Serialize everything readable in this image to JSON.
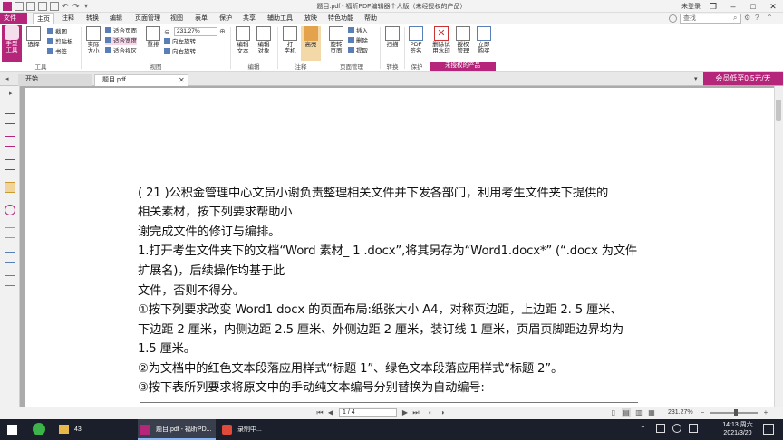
{
  "window": {
    "title": "题目.pdf - 福昕PDF编辑器个人版（未经授权的产品）",
    "login": "未登录"
  },
  "menu": {
    "items": [
      "文件",
      "主页",
      "注释",
      "转换",
      "编辑",
      "页面管理",
      "视图",
      "表单",
      "保护",
      "共享",
      "辅助工具",
      "放映",
      "特色功能",
      "帮助"
    ],
    "active": "主页",
    "search_placeholder": "查找"
  },
  "ribbon": {
    "tools_group": {
      "label": "工具",
      "hand": "手型\n工具",
      "select": "选择",
      "snapshot": "截图",
      "clipboard": "剪贴板",
      "bookmark": "书签"
    },
    "view_group": {
      "label": "视图",
      "actual": "实际\n大小",
      "fit_page": "适合页面",
      "fit_width": "适合宽度",
      "fit_view": "适合视区",
      "reflow": "重排",
      "zoom_value": "231.27%",
      "rotate_left": "向左旋转",
      "rotate_right": "向右旋转"
    },
    "edit_group": {
      "label": "编辑",
      "edit_text": "编辑\n文本",
      "edit_object": "编辑\n对象"
    },
    "annot_group": {
      "label": "注释",
      "typewriter": "打\n字机",
      "highlight": "高亮"
    },
    "page_group": {
      "label": "页面管理",
      "rotate": "旋转\n页面",
      "insert": "插入",
      "delete": "删除",
      "extract": "提取"
    },
    "convert_group": {
      "label": "转换",
      "scan": "扫描"
    },
    "protect_group": {
      "label": "保护",
      "sign": "PDF\n签名"
    },
    "unlicensed_group": {
      "label": "未授权的产品",
      "remove_watermark": "删除试\n用水印",
      "license": "授权\n管理",
      "buy": "立即\n购买"
    }
  },
  "promo": "会员低至0.5元/天",
  "tabs": [
    {
      "label": "开始"
    },
    {
      "label": "题目.pdf"
    }
  ],
  "document": {
    "lines": [
      "( 21 )公积金管理中心文员小谢负责整理相关文件并下发各部门，利用考生文件夹下提供的",
      "相关素材，按下列要求帮助小",
      "谢完成文件的修订与编排。",
      "1.打开考生文件夹下的文档“Word  素材_ 1  .docx”,将其另存为“Word1.docx*” (“.docx 为文件",
      "扩展名)，后续操作均基于此",
      "文件，否则不得分。",
      "①按下列要求改变 Word1 docx 的页面布局:纸张大小 A4，对称页边距，上边距 2. 5 厘米、",
      "下边距 2 厘米，内侧边距 2.5 厘米、外侧边距 2 厘米，装订线 1 厘米，页眉页脚距边界均为",
      "1.5 厘米。",
      "②为文档中的红色文本段落应用样式“标题 1”、绿色文本段落应用样式“标题 2”。",
      "③按下表所列要求将原文中的手动纯文本编号分别替换为自动编号:"
    ]
  },
  "status": {
    "page": "1 / 4",
    "zoom": "231.27%"
  },
  "taskbar": {
    "items": [
      {
        "label": "43"
      },
      {
        "label": "题目.pdf - 福昕PD..."
      },
      {
        "label": "录制中..."
      }
    ],
    "time": "14:13 周六",
    "date": "2021/3/20"
  },
  "colors": {
    "accent": "#b5267a",
    "taskbar": "#1a1f2b"
  }
}
